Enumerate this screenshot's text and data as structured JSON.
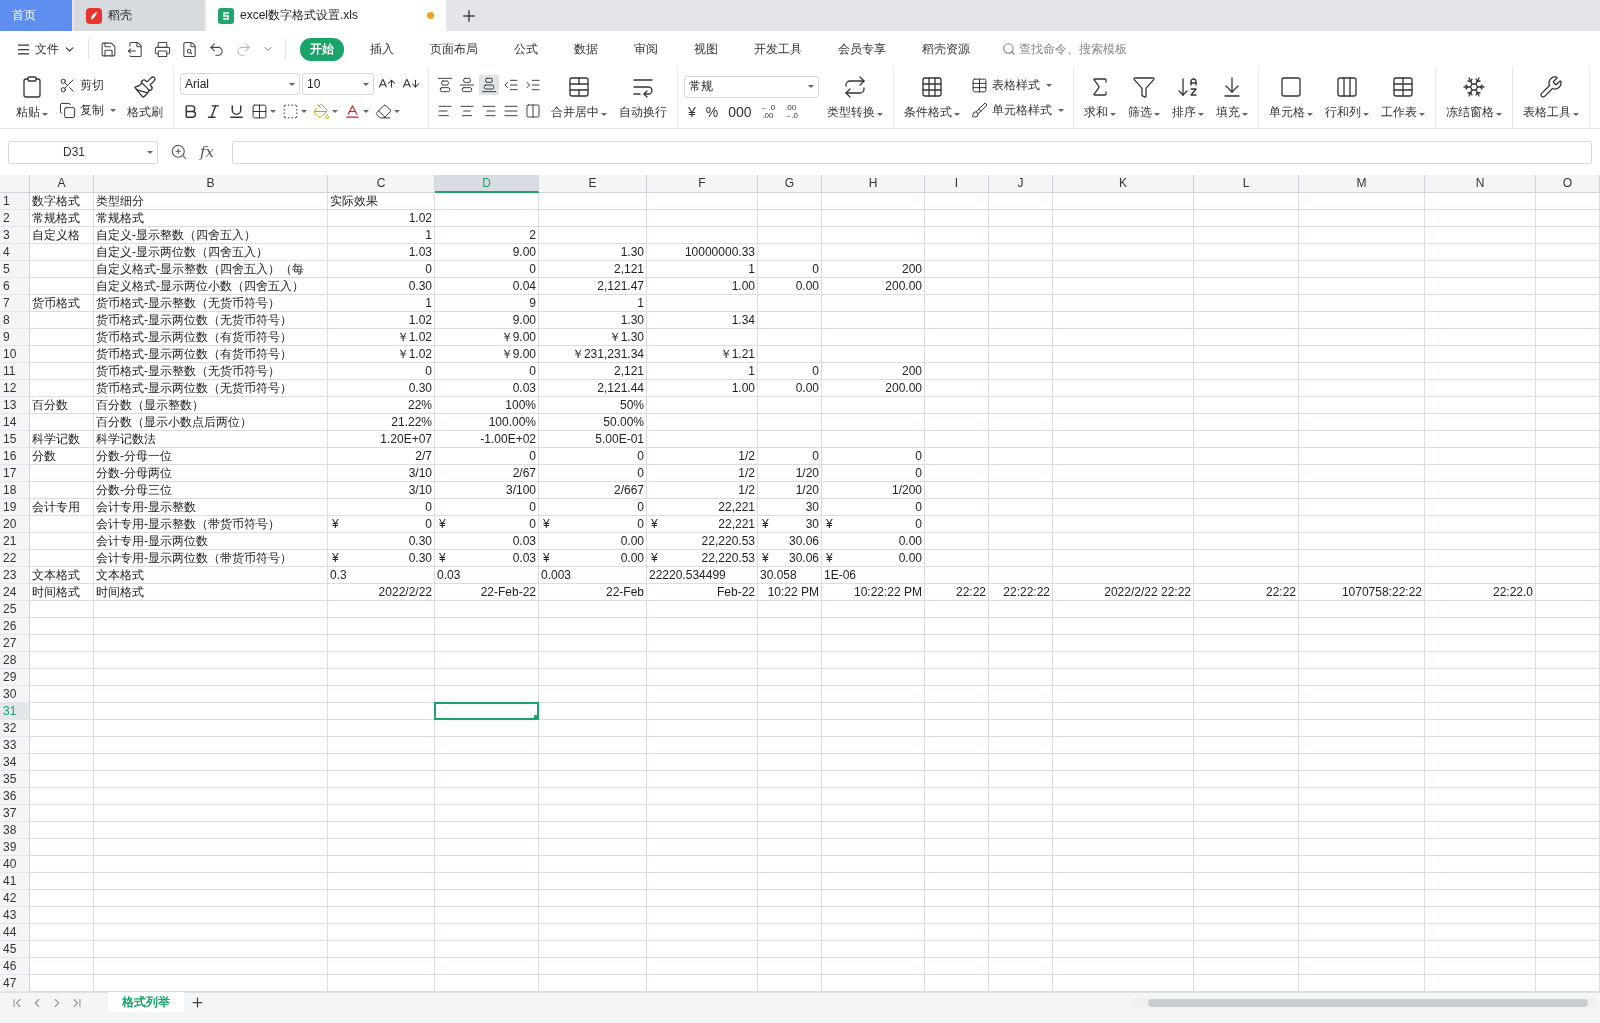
{
  "tabs": [
    {
      "kind": "home",
      "label": "首页",
      "selected": false,
      "modified": false
    },
    {
      "kind": "app",
      "label": "稻壳",
      "selected": false,
      "modified": false
    },
    {
      "kind": "document",
      "label": "excel数字格式设置.xls",
      "selected": true,
      "modified": true
    }
  ],
  "file_menu": {
    "label": "文件"
  },
  "quick_access": [
    {
      "kind": "save",
      "disabled": false
    },
    {
      "kind": "export",
      "disabled": false
    },
    {
      "kind": "print",
      "disabled": false
    },
    {
      "kind": "preview",
      "disabled": false
    },
    {
      "kind": "undo",
      "disabled": false
    },
    {
      "kind": "redo",
      "disabled": true
    },
    {
      "kind": "more",
      "disabled": false
    }
  ],
  "menu_tabs": [
    {
      "label": "开始",
      "selected": true
    },
    {
      "label": "插入",
      "selected": false
    },
    {
      "label": "页面布局",
      "selected": false
    },
    {
      "label": "公式",
      "selected": false
    },
    {
      "label": "数据",
      "selected": false
    },
    {
      "label": "审阅",
      "selected": false
    },
    {
      "label": "视图",
      "selected": false
    },
    {
      "label": "开发工具",
      "selected": false
    },
    {
      "label": "会员专享",
      "selected": false
    },
    {
      "label": "稻壳资源",
      "selected": false
    }
  ],
  "search": {
    "placeholder": "查找命令、搜索模板"
  },
  "ribbon": {
    "clipboard": [
      {
        "kind": "large",
        "label": "粘贴",
        "menu": true
      },
      {
        "kind": "small",
        "label": "剪切",
        "menu": false
      },
      {
        "kind": "small",
        "label": "复制",
        "menu": true
      },
      {
        "kind": "large",
        "label": "格式刷",
        "menu": false
      }
    ],
    "font": {
      "name": "Arial",
      "size": "10"
    },
    "vertical_align": [
      {
        "selected": false
      },
      {
        "selected": false
      },
      {
        "selected": true
      }
    ],
    "alignment": [
      {
        "kind": "large",
        "label": "合并居中",
        "menu": true
      },
      {
        "kind": "large",
        "label": "自动换行",
        "menu": false
      }
    ],
    "number_format": {
      "value": "常规",
      "buttons": [
        "¥",
        "%",
        "000"
      ],
      "decimal_buttons": [
        {
          "top": "←.0",
          "bottom": ".00"
        },
        {
          "top": ".00",
          "bottom": "→.0"
        }
      ]
    },
    "convert": {
      "kind": "large",
      "label": "类型转换",
      "menu": true
    },
    "tool_groups": [
      [
        {
          "kind": "large",
          "label": "条件格式",
          "menu": true
        },
        {
          "kind": "small",
          "label": "表格样式",
          "menu": true
        },
        {
          "kind": "small",
          "label": "单元格样式",
          "menu": true
        }
      ],
      [
        {
          "kind": "large",
          "label": "求和",
          "menu": true
        },
        {
          "kind": "large",
          "label": "筛选",
          "menu": true
        },
        {
          "kind": "large",
          "label": "排序",
          "menu": true
        },
        {
          "kind": "large",
          "label": "填充",
          "menu": true
        }
      ],
      [
        {
          "kind": "large",
          "label": "单元格",
          "menu": true
        },
        {
          "kind": "large",
          "label": "行和列",
          "menu": true
        },
        {
          "kind": "large",
          "label": "工作表",
          "menu": true
        }
      ],
      [
        {
          "kind": "large",
          "label": "冻结窗格",
          "menu": true
        }
      ],
      [
        {
          "kind": "large",
          "label": "表格工具",
          "menu": true
        }
      ]
    ]
  },
  "formula_bar": {
    "name_box": "D31",
    "function_label": "fx"
  },
  "columns": [
    {
      "label": "A",
      "selected": false
    },
    {
      "label": "B",
      "selected": false
    },
    {
      "label": "C",
      "selected": false
    },
    {
      "label": "D",
      "selected": true
    },
    {
      "label": "E",
      "selected": false
    },
    {
      "label": "F",
      "selected": false
    },
    {
      "label": "G",
      "selected": false
    },
    {
      "label": "H",
      "selected": false
    },
    {
      "label": "I",
      "selected": false
    },
    {
      "label": "J",
      "selected": false
    },
    {
      "label": "K",
      "selected": false
    },
    {
      "label": "L",
      "selected": false
    },
    {
      "label": "M",
      "selected": false
    },
    {
      "label": "N",
      "selected": false
    },
    {
      "label": "O",
      "selected": false
    }
  ],
  "rows": [
    {
      "label": "1",
      "selected": false,
      "cells": {
        "A": {
          "kind": "text",
          "text": "数字格式"
        },
        "B": {
          "kind": "text",
          "text": "类型细分"
        },
        "C": {
          "kind": "text",
          "text": "实际效果"
        }
      }
    },
    {
      "label": "2",
      "selected": false,
      "cells": {
        "A": {
          "kind": "text",
          "text": "常规格式"
        },
        "B": {
          "kind": "text",
          "text": "常规格式"
        },
        "C": {
          "kind": "number",
          "text": "1.02"
        }
      }
    },
    {
      "label": "3",
      "selected": false,
      "cells": {
        "A": {
          "kind": "text",
          "text": "自定义格"
        },
        "B": {
          "kind": "text",
          "text": "自定义-显示整数（四舍五入）"
        },
        "C": {
          "kind": "number",
          "text": "1"
        },
        "D": {
          "kind": "number",
          "text": "2"
        }
      }
    },
    {
      "label": "4",
      "selected": false,
      "cells": {
        "B": {
          "kind": "text",
          "text": "自定义-显示两位数（四舍五入）"
        },
        "C": {
          "kind": "number",
          "text": "1.03"
        },
        "D": {
          "kind": "number",
          "text": "9.00"
        },
        "E": {
          "kind": "number",
          "text": "1.30"
        },
        "F": {
          "kind": "number",
          "text": "10000000.33"
        }
      }
    },
    {
      "label": "5",
      "selected": false,
      "cells": {
        "B": {
          "kind": "text",
          "text": "自定义格式-显示整数（四舍五入）（每"
        },
        "C": {
          "kind": "number",
          "text": "0"
        },
        "D": {
          "kind": "number",
          "text": "0"
        },
        "E": {
          "kind": "number",
          "text": "2,121"
        },
        "F": {
          "kind": "number",
          "text": "1"
        },
        "G": {
          "kind": "number",
          "text": "0"
        },
        "H": {
          "kind": "number",
          "text": "200"
        }
      }
    },
    {
      "label": "6",
      "selected": false,
      "cells": {
        "B": {
          "kind": "text",
          "text": "自定义格式-显示两位小数（四舍五入）"
        },
        "C": {
          "kind": "number",
          "text": "0.30"
        },
        "D": {
          "kind": "number",
          "text": "0.04"
        },
        "E": {
          "kind": "number",
          "text": "2,121.47"
        },
        "F": {
          "kind": "number",
          "text": "1.00"
        },
        "G": {
          "kind": "number",
          "text": "0.00"
        },
        "H": {
          "kind": "number",
          "text": "200.00"
        }
      }
    },
    {
      "label": "7",
      "selected": false,
      "cells": {
        "A": {
          "kind": "text",
          "text": "货币格式"
        },
        "B": {
          "kind": "text",
          "text": "货币格式-显示整数（无货币符号）"
        },
        "C": {
          "kind": "number",
          "text": "1"
        },
        "D": {
          "kind": "number",
          "text": "9"
        },
        "E": {
          "kind": "number",
          "text": "1"
        }
      }
    },
    {
      "label": "8",
      "selected": false,
      "cells": {
        "B": {
          "kind": "text",
          "text": "货币格式-显示两位数（无货币符号）"
        },
        "C": {
          "kind": "number",
          "text": "1.02"
        },
        "D": {
          "kind": "number",
          "text": "9.00"
        },
        "E": {
          "kind": "number",
          "text": "1.30"
        },
        "F": {
          "kind": "number",
          "text": "1.34"
        }
      }
    },
    {
      "label": "9",
      "selected": false,
      "cells": {
        "B": {
          "kind": "text",
          "text": "货币格式-显示两位数（有货币符号）"
        },
        "C": {
          "kind": "number",
          "text": "￥1.02"
        },
        "D": {
          "kind": "number",
          "text": "￥9.00"
        },
        "E": {
          "kind": "number",
          "text": "￥1.30"
        }
      }
    },
    {
      "label": "10",
      "selected": false,
      "cells": {
        "B": {
          "kind": "text",
          "text": "货币格式-显示两位数（有货币符号）"
        },
        "C": {
          "kind": "number",
          "text": "￥1.02"
        },
        "D": {
          "kind": "number",
          "text": "￥9.00"
        },
        "E": {
          "kind": "number",
          "text": "￥231,231.34"
        },
        "F": {
          "kind": "number",
          "text": "￥1.21"
        }
      }
    },
    {
      "label": "11",
      "selected": false,
      "cells": {
        "B": {
          "kind": "text",
          "text": "货币格式-显示整数（无货币符号）"
        },
        "C": {
          "kind": "number",
          "text": "0"
        },
        "D": {
          "kind": "number",
          "text": "0"
        },
        "E": {
          "kind": "number",
          "text": "2,121"
        },
        "F": {
          "kind": "number",
          "text": "1"
        },
        "G": {
          "kind": "number",
          "text": "0"
        },
        "H": {
          "kind": "number",
          "text": "200"
        }
      }
    },
    {
      "label": "12",
      "selected": false,
      "cells": {
        "B": {
          "kind": "text",
          "text": "货币格式-显示两位数（无货币符号）"
        },
        "C": {
          "kind": "number",
          "text": "0.30"
        },
        "D": {
          "kind": "number",
          "text": "0.03"
        },
        "E": {
          "kind": "number",
          "text": "2,121.44"
        },
        "F": {
          "kind": "number",
          "text": "1.00"
        },
        "G": {
          "kind": "number",
          "text": "0.00"
        },
        "H": {
          "kind": "number",
          "text": "200.00"
        }
      }
    },
    {
      "label": "13",
      "selected": false,
      "cells": {
        "A": {
          "kind": "text",
          "text": "百分数"
        },
        "B": {
          "kind": "text",
          "text": "百分数（显示整数）"
        },
        "C": {
          "kind": "number",
          "text": "22%"
        },
        "D": {
          "kind": "number",
          "text": "100%"
        },
        "E": {
          "kind": "number",
          "text": "50%"
        }
      }
    },
    {
      "label": "14",
      "selected": false,
      "cells": {
        "B": {
          "kind": "text",
          "text": "百分数（显示小数点后两位）"
        },
        "C": {
          "kind": "number",
          "text": "21.22%"
        },
        "D": {
          "kind": "number",
          "text": "100.00%"
        },
        "E": {
          "kind": "number",
          "text": "50.00%"
        }
      }
    },
    {
      "label": "15",
      "selected": false,
      "cells": {
        "A": {
          "kind": "text",
          "text": "科学记数"
        },
        "B": {
          "kind": "text",
          "text": "科学记数法"
        },
        "C": {
          "kind": "number",
          "text": "1.20E+07"
        },
        "D": {
          "kind": "number",
          "text": "-1.00E+02"
        },
        "E": {
          "kind": "number",
          "text": "5.00E-01"
        }
      }
    },
    {
      "label": "16",
      "selected": false,
      "cells": {
        "A": {
          "kind": "text",
          "text": "分数"
        },
        "B": {
          "kind": "text",
          "text": "分数-分母一位"
        },
        "C": {
          "kind": "number",
          "text": "2/7"
        },
        "D": {
          "kind": "number",
          "text": "0"
        },
        "E": {
          "kind": "number",
          "text": "0"
        },
        "F": {
          "kind": "number",
          "text": "1/2"
        },
        "G": {
          "kind": "number",
          "text": "0"
        },
        "H": {
          "kind": "number",
          "text": "0"
        }
      }
    },
    {
      "label": "17",
      "selected": false,
      "cells": {
        "B": {
          "kind": "text",
          "text": "分数-分母两位"
        },
        "C": {
          "kind": "number",
          "text": "3/10"
        },
        "D": {
          "kind": "number",
          "text": "2/67"
        },
        "E": {
          "kind": "number",
          "text": "0"
        },
        "F": {
          "kind": "number",
          "text": "1/2"
        },
        "G": {
          "kind": "number",
          "text": "1/20"
        },
        "H": {
          "kind": "number",
          "text": "0"
        }
      }
    },
    {
      "label": "18",
      "selected": false,
      "cells": {
        "B": {
          "kind": "text",
          "text": "分数-分母三位"
        },
        "C": {
          "kind": "number",
          "text": "3/10"
        },
        "D": {
          "kind": "number",
          "text": "3/100"
        },
        "E": {
          "kind": "number",
          "text": "2/667"
        },
        "F": {
          "kind": "number",
          "text": "1/2"
        },
        "G": {
          "kind": "number",
          "text": "1/20"
        },
        "H": {
          "kind": "number",
          "text": "1/200"
        }
      }
    },
    {
      "label": "19",
      "selected": false,
      "cells": {
        "A": {
          "kind": "text",
          "text": "会计专用"
        },
        "B": {
          "kind": "text",
          "text": "会计专用-显示整数"
        },
        "C": {
          "kind": "number",
          "text": "0"
        },
        "D": {
          "kind": "number",
          "text": "0"
        },
        "E": {
          "kind": "number",
          "text": "0"
        },
        "F": {
          "kind": "number",
          "text": "22,221"
        },
        "G": {
          "kind": "number",
          "text": "30"
        },
        "H": {
          "kind": "number",
          "text": "0"
        }
      }
    },
    {
      "label": "20",
      "selected": false,
      "cells": {
        "B": {
          "kind": "text",
          "text": "会计专用-显示整数（带货币符号）"
        },
        "C": {
          "kind": "accounting",
          "symbol": "¥",
          "text": "0"
        },
        "D": {
          "kind": "accounting",
          "symbol": "¥",
          "text": "0"
        },
        "E": {
          "kind": "accounting",
          "symbol": "¥",
          "text": "0"
        },
        "F": {
          "kind": "accounting",
          "symbol": "¥",
          "text": "22,221"
        },
        "G": {
          "kind": "accounting",
          "symbol": "¥",
          "text": "30"
        },
        "H": {
          "kind": "accounting",
          "symbol": "¥",
          "text": "0"
        }
      }
    },
    {
      "label": "21",
      "selected": false,
      "cells": {
        "B": {
          "kind": "text",
          "text": "会计专用-显示两位数"
        },
        "C": {
          "kind": "number",
          "text": "0.30"
        },
        "D": {
          "kind": "number",
          "text": "0.03"
        },
        "E": {
          "kind": "number",
          "text": "0.00"
        },
        "F": {
          "kind": "number",
          "text": "22,220.53"
        },
        "G": {
          "kind": "number",
          "text": "30.06"
        },
        "H": {
          "kind": "number",
          "text": "0.00"
        }
      }
    },
    {
      "label": "22",
      "selected": false,
      "cells": {
        "B": {
          "kind": "text",
          "text": "会计专用-显示两位数（带货币符号）"
        },
        "C": {
          "kind": "accounting",
          "symbol": "¥",
          "text": "0.30"
        },
        "D": {
          "kind": "accounting",
          "symbol": "¥",
          "text": "0.03"
        },
        "E": {
          "kind": "accounting",
          "symbol": "¥",
          "text": "0.00"
        },
        "F": {
          "kind": "accounting",
          "symbol": "¥",
          "text": "22,220.53"
        },
        "G": {
          "kind": "accounting",
          "symbol": "¥",
          "text": "30.06"
        },
        "H": {
          "kind": "accounting",
          "symbol": "¥",
          "text": "0.00"
        }
      }
    },
    {
      "label": "23",
      "selected": false,
      "cells": {
        "A": {
          "kind": "text",
          "text": "文本格式"
        },
        "B": {
          "kind": "text",
          "text": "文本格式"
        },
        "C": {
          "kind": "text",
          "text": "0.3"
        },
        "D": {
          "kind": "text",
          "text": "0.03"
        },
        "E": {
          "kind": "text",
          "text": "0.003"
        },
        "F": {
          "kind": "text",
          "text": "22220.534499"
        },
        "G": {
          "kind": "text",
          "text": "30.058"
        },
        "H": {
          "kind": "text",
          "text": "1E-06"
        }
      }
    },
    {
      "label": "24",
      "selected": false,
      "cells": {
        "A": {
          "kind": "text",
          "text": "时间格式"
        },
        "B": {
          "kind": "text",
          "text": "时间格式"
        },
        "C": {
          "kind": "number",
          "text": "2022/2/22"
        },
        "D": {
          "kind": "number",
          "text": "22-Feb-22"
        },
        "E": {
          "kind": "number",
          "text": "22-Feb"
        },
        "F": {
          "kind": "number",
          "text": "Feb-22"
        },
        "G": {
          "kind": "number",
          "text": "10:22 PM"
        },
        "H": {
          "kind": "number",
          "text": "10:22:22 PM"
        },
        "I": {
          "kind": "number",
          "text": "22:22"
        },
        "J": {
          "kind": "number",
          "text": "22:22:22"
        },
        "K": {
          "kind": "number",
          "text": "2022/2/22 22:22"
        },
        "L": {
          "kind": "number",
          "text": "22:22"
        },
        "M": {
          "kind": "number",
          "text": "1070758:22:22"
        },
        "N": {
          "kind": "number",
          "text": "22:22.0"
        }
      }
    },
    {
      "label": "25",
      "selected": false
    },
    {
      "label": "26",
      "selected": false
    },
    {
      "label": "27",
      "selected": false
    },
    {
      "label": "28",
      "selected": false
    },
    {
      "label": "29",
      "selected": false
    },
    {
      "label": "30",
      "selected": false
    },
    {
      "label": "31",
      "selected": true
    },
    {
      "label": "32",
      "selected": false
    },
    {
      "label": "33",
      "selected": false
    },
    {
      "label": "34",
      "selected": false
    },
    {
      "label": "35",
      "selected": false
    },
    {
      "label": "36",
      "selected": false
    },
    {
      "label": "37",
      "selected": false
    },
    {
      "label": "38",
      "selected": false
    },
    {
      "label": "39",
      "selected": false
    },
    {
      "label": "40",
      "selected": false
    },
    {
      "label": "41",
      "selected": false
    },
    {
      "label": "42",
      "selected": false
    },
    {
      "label": "43",
      "selected": false
    },
    {
      "label": "44",
      "selected": false
    },
    {
      "label": "45",
      "selected": false
    },
    {
      "label": "46",
      "selected": false
    },
    {
      "label": "47",
      "selected": false
    }
  ],
  "sheet_tabs": [
    {
      "label": "格式列举",
      "selected": true
    }
  ]
}
